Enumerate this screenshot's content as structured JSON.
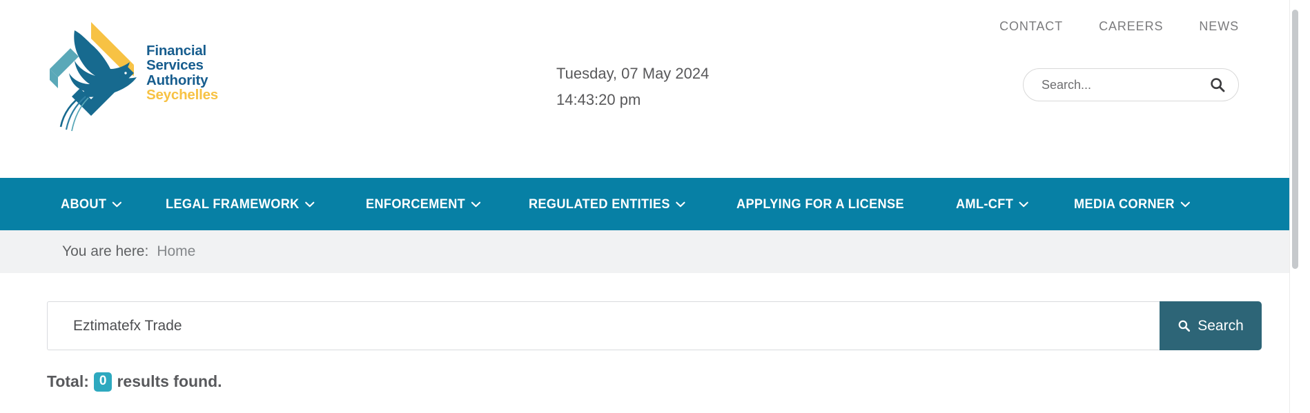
{
  "brand": {
    "logo_icon": "fsa-tropicbird-diamond-logo",
    "name_line1": "Financial",
    "name_line2": "Services",
    "name_line3": "Authority",
    "name_line4": "Seychelles",
    "color_blue": "#175d8e",
    "color_gold": "#f7c244",
    "color_teal": "#5aa8b8"
  },
  "header": {
    "date": "Tuesday, 07 May 2024",
    "time": "14:43:20 pm",
    "utility_links": [
      {
        "label": "CONTACT"
      },
      {
        "label": "CAREERS"
      },
      {
        "label": "NEWS"
      }
    ],
    "search": {
      "placeholder": "Search...",
      "value": "",
      "icon": "search-icon"
    }
  },
  "mainnav": {
    "background": "#0780a5",
    "items": [
      {
        "label": "ABOUT",
        "has_dropdown": true
      },
      {
        "label": "LEGAL FRAMEWORK",
        "has_dropdown": true
      },
      {
        "label": "ENFORCEMENT",
        "has_dropdown": true
      },
      {
        "label": "REGULATED ENTITIES",
        "has_dropdown": true
      },
      {
        "label": "APPLYING FOR A LICENSE",
        "has_dropdown": false
      },
      {
        "label": "AML-CFT",
        "has_dropdown": true
      },
      {
        "label": "MEDIA CORNER",
        "has_dropdown": true
      }
    ]
  },
  "breadcrumb": {
    "label": "You are here:",
    "items": [
      {
        "label": "Home"
      }
    ]
  },
  "search_results": {
    "query_value": "Eztimatefx Trade",
    "query_placeholder": "Search...",
    "button_label": "Search",
    "button_icon": "search-icon",
    "button_color": "#2d6577",
    "total_prefix": "Total:",
    "total_count": "0",
    "total_suffix": "results found.",
    "badge_color": "#2ea9bf"
  }
}
